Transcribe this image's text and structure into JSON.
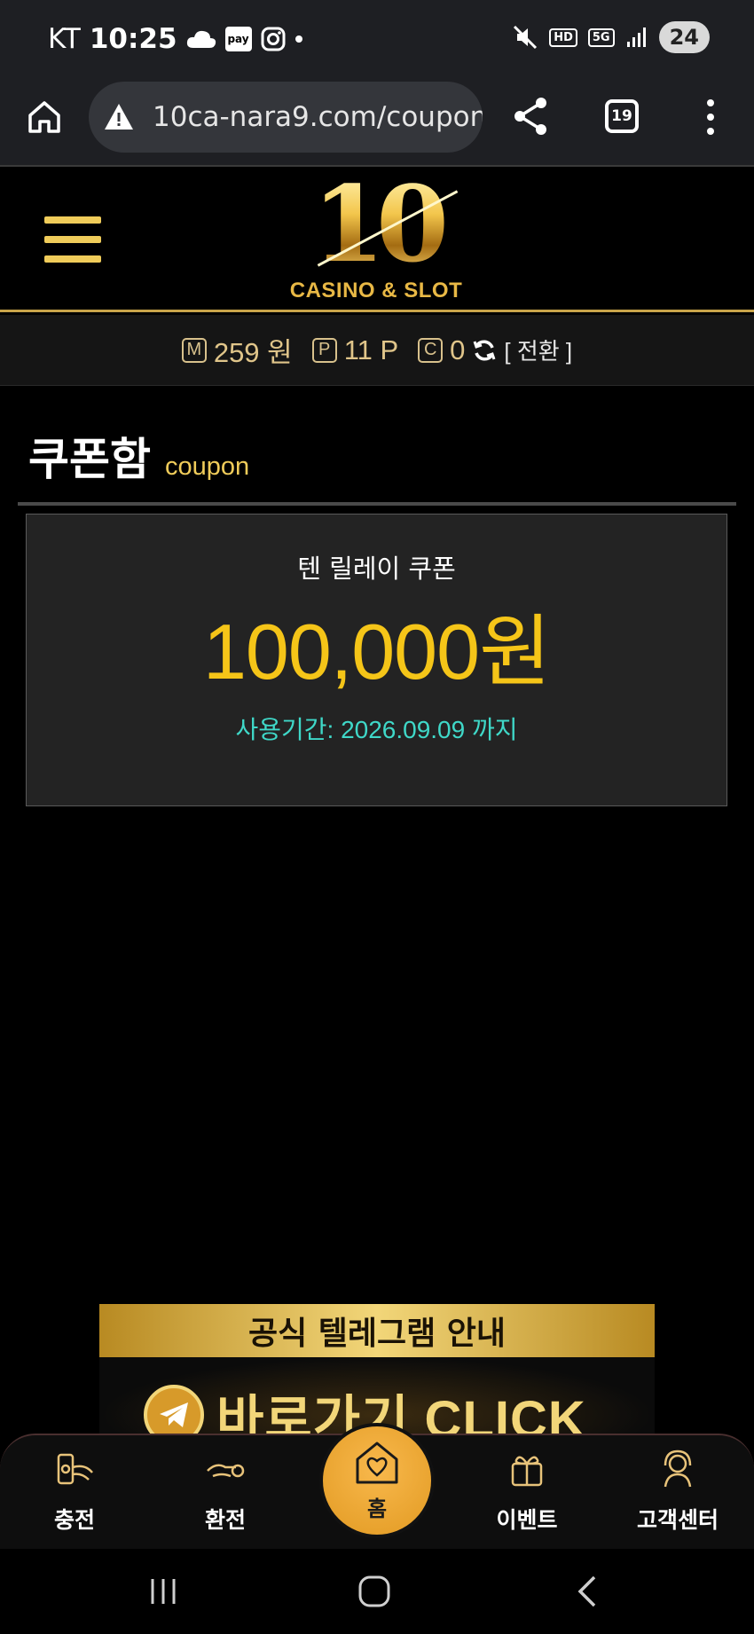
{
  "status_bar": {
    "carrier": "KT",
    "time": "10:25",
    "pay_label": "pay",
    "hd_label": "HD",
    "network_label": "5G",
    "battery": "24"
  },
  "browser": {
    "url": "10ca-nara9.com/coupon",
    "tab_count": "19"
  },
  "site": {
    "logo_number": "10",
    "logo_subtitle": "CASINO & SLOT",
    "accent_color": "#f0cc5a"
  },
  "balance": {
    "money_icon": "M",
    "money": "259 원",
    "point_icon": "P",
    "points": "11 P",
    "coin_icon": "C",
    "coins": "0",
    "convert_label": "[ 전환 ]"
  },
  "page": {
    "title": "쿠폰함",
    "subtitle": "coupon"
  },
  "coupon": {
    "name": "텐 릴레이 쿠폰",
    "amount": "100,000원",
    "expiry": "사용기간: 2026.09.09 까지",
    "amount_color": "#f5c518",
    "expiry_color": "#3fd8c8"
  },
  "banner": {
    "title": "공식 텔레그램 안내",
    "cta": "바로가기 CLICK"
  },
  "bottom_nav": {
    "deposit": "충전",
    "withdraw": "환전",
    "home": "홈",
    "event": "이벤트",
    "support": "고객센터"
  }
}
